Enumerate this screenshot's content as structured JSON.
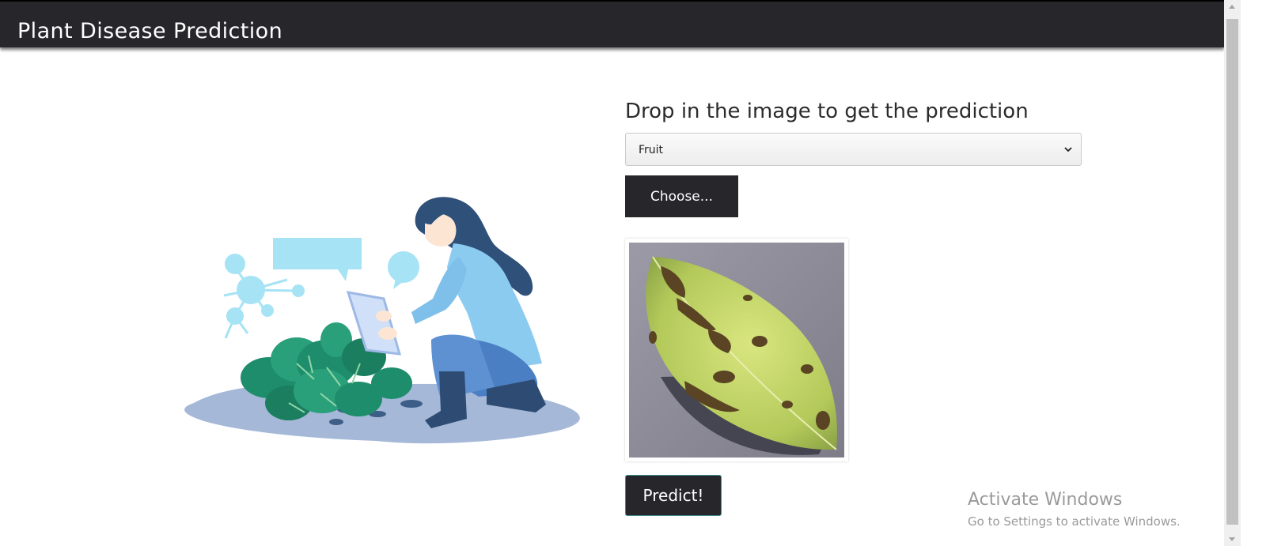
{
  "header": {
    "title": "Plant Disease Prediction"
  },
  "main": {
    "heading": "Drop in the image to get the prediction",
    "category_select": {
      "selected": "Fruit"
    },
    "choose_button": "Choose...",
    "predict_button": "Predict!"
  },
  "illustration": {
    "icon": "farmer-with-tablet-illustration"
  },
  "preview": {
    "icon": "diseased-leaf-image"
  },
  "os_watermark": {
    "title": "Activate Windows",
    "subtitle": "Go to Settings to activate Windows."
  },
  "colors": {
    "navbar": "#27272b",
    "button": "#27272b",
    "text": "#2b2b2b",
    "illustration_light_blue": "#a6e3f5",
    "illustration_leaf": "#1e8d6b"
  }
}
